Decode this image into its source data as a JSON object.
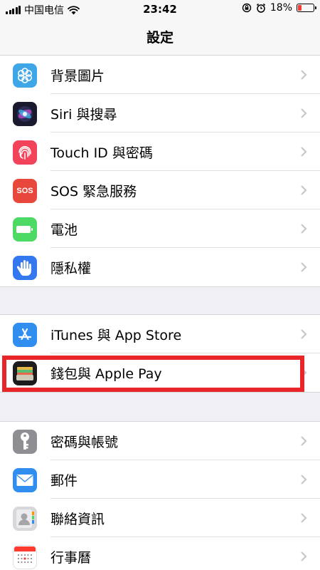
{
  "status_bar": {
    "carrier": "中国电信",
    "time": "23:42",
    "battery_percent": "18%"
  },
  "nav": {
    "title": "設定"
  },
  "groups": [
    {
      "items": [
        {
          "label": "背景圖片",
          "icon": "wallpaper-icon",
          "color": "#3fa6e8"
        },
        {
          "label": "Siri 與搜尋",
          "icon": "siri-icon",
          "color": "#1a1a2e"
        },
        {
          "label": "Touch ID 與密碼",
          "icon": "fingerprint-icon",
          "color": "#f2435a"
        },
        {
          "label": "SOS 緊急服務",
          "icon": "sos-icon",
          "color": "#e8483b",
          "icon_text": "SOS"
        },
        {
          "label": "電池",
          "icon": "battery-icon",
          "color": "#4cd964"
        },
        {
          "label": "隱私權",
          "icon": "hand-icon",
          "color": "#3478f0"
        }
      ]
    },
    {
      "items": [
        {
          "label": "iTunes 與 App Store",
          "icon": "app-store-icon",
          "color": "#2f8ef0"
        },
        {
          "label": "錢包與 Apple Pay",
          "icon": "wallet-icon",
          "color": "#1c1c1e"
        }
      ]
    },
    {
      "items": [
        {
          "label": "密碼與帳號",
          "icon": "key-icon",
          "color": "#8e8e93"
        },
        {
          "label": "郵件",
          "icon": "mail-icon",
          "color": "#2f8ef0"
        },
        {
          "label": "聯絡資訊",
          "icon": "contacts-icon",
          "color": "#c7c7cc"
        },
        {
          "label": "行事曆",
          "icon": "calendar-icon",
          "color": "#ffffff"
        }
      ]
    }
  ],
  "annotation": {
    "highlighted_item": "錢包與 Apple Pay",
    "color": "#e8262a"
  }
}
